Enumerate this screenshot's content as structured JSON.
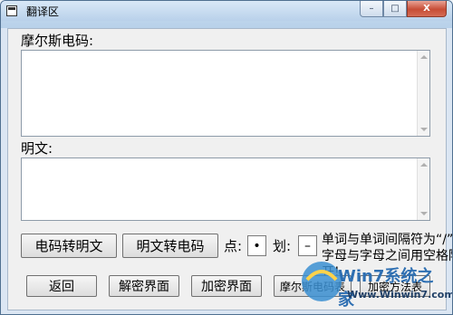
{
  "window": {
    "title": "翻译区",
    "controls": {
      "minimize": "–",
      "maximize": "□",
      "close": "X"
    }
  },
  "morse": {
    "label": "摩尔斯电码:",
    "value": ""
  },
  "plain": {
    "label": "明文:",
    "value": ""
  },
  "actions": {
    "morse_to_plain": "电码转明文",
    "plain_to_morse": "明文转电码",
    "dot_label": "点:",
    "dot_value": "•",
    "dash_label": "划:",
    "dash_value": "–"
  },
  "hint": "单词与单词间隔符为“/”,字母与字母之间用空格隔开!",
  "bottom_buttons": {
    "back": "返回",
    "decrypt_ui": "解密界面",
    "encrypt_ui": "加密界面",
    "morse_table": "摩尔斯电码表",
    "encrypt_table": "加密方法表"
  },
  "watermark": {
    "brand": "Win7系统之家",
    "url": "Www.Winwin7.com"
  }
}
